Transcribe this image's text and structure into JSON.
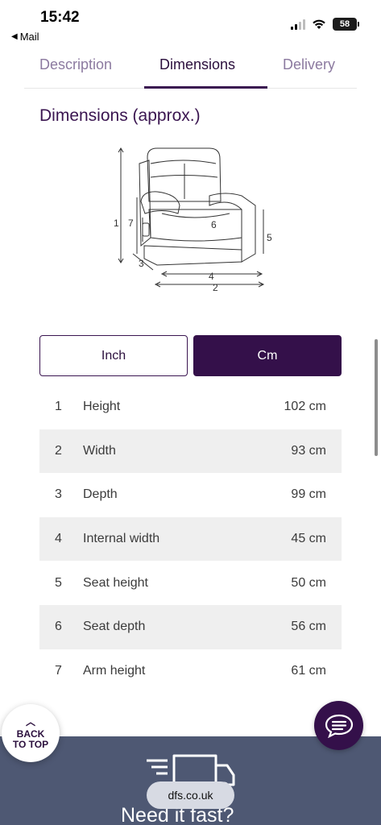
{
  "status_bar": {
    "time": "15:42",
    "back_label": "Mail",
    "battery": "58"
  },
  "tabs": [
    {
      "label": "Description",
      "active": false
    },
    {
      "label": "Dimensions",
      "active": true
    },
    {
      "label": "Delivery",
      "active": false
    }
  ],
  "section_title": "Dimensions (approx.)",
  "diagram": {
    "labels": {
      "height": "1",
      "seat_height_left": "7",
      "seat_depth": "6",
      "seat_height": "5",
      "depth": "3",
      "internal_width": "4",
      "width": "2"
    }
  },
  "units": {
    "inch_label": "Inch",
    "cm_label": "Cm",
    "selected": "Cm"
  },
  "dimensions": [
    {
      "num": "1",
      "label": "Height",
      "value": "102 cm"
    },
    {
      "num": "2",
      "label": "Width",
      "value": "93 cm"
    },
    {
      "num": "3",
      "label": "Depth",
      "value": "99 cm"
    },
    {
      "num": "4",
      "label": "Internal width",
      "value": "45 cm"
    },
    {
      "num": "5",
      "label": "Seat height",
      "value": "50 cm"
    },
    {
      "num": "6",
      "label": "Seat depth",
      "value": "56 cm"
    },
    {
      "num": "7",
      "label": "Arm height",
      "value": "61 cm"
    }
  ],
  "back_to_top": {
    "line1": "BACK",
    "line2": "TO TOP"
  },
  "footer": {
    "heading": "Need it fast?"
  },
  "url_bar": {
    "domain": "dfs.co.uk"
  },
  "colors": {
    "brand_purple": "#34104a",
    "footer_slate": "#4e5873",
    "row_stripe": "#efefef"
  }
}
